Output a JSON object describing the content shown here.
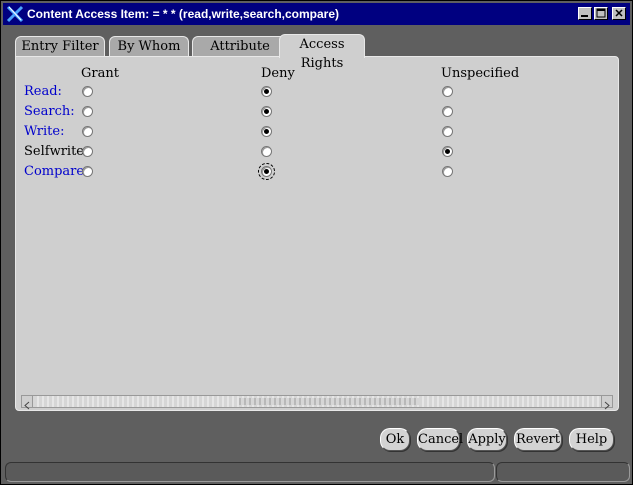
{
  "window": {
    "title": "Content Access Item:  = * * (read,write,search,compare)",
    "controls": {
      "minimize_icon": "minimize-icon",
      "maximize_icon": "maximize-icon",
      "close_icon": "close-icon"
    }
  },
  "tabs": [
    {
      "label": "Entry Filter",
      "active": false
    },
    {
      "label": "By Whom",
      "active": false
    },
    {
      "label": "Attribute",
      "active": false
    },
    {
      "label": "Access Rights",
      "active": true
    }
  ],
  "rights": {
    "columns": [
      "Grant",
      "Deny",
      "Unspecified"
    ],
    "rows": [
      {
        "label": "Read:",
        "color": "#0000cc",
        "selected": "Deny"
      },
      {
        "label": "Search:",
        "color": "#0000cc",
        "selected": "Deny"
      },
      {
        "label": "Write:",
        "color": "#0000cc",
        "selected": "Deny"
      },
      {
        "label": "Selfwrite:",
        "color": "#000000",
        "selected": "Unspecified"
      },
      {
        "label": "Compare:",
        "color": "#0000cc",
        "selected": "Deny",
        "focused": "Deny"
      }
    ]
  },
  "buttons": {
    "ok": "Ok",
    "cancel": "Cancel",
    "apply": "Apply",
    "revert": "Revert",
    "help": "Help"
  },
  "colors": {
    "title_bar": "#000080",
    "label_blue": "#0000cc",
    "panel": "#cfcfcf"
  }
}
